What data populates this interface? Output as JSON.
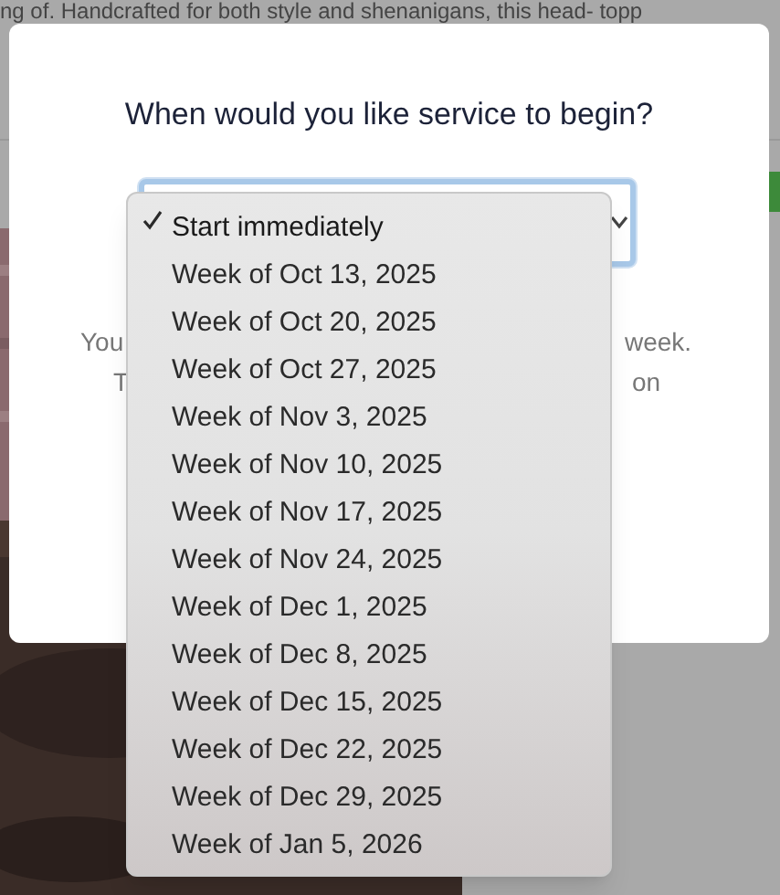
{
  "page": {
    "intro_text": "ng of. Handcrafted for both style and shenanigans, this head- topp"
  },
  "modal": {
    "title": "When would you like service to begin?",
    "note_fragments": [
      "You",
      "week.",
      "T",
      "on"
    ],
    "select": {
      "expanded": true,
      "options": [
        {
          "label": "Start immediately",
          "selected": true
        },
        {
          "label": "Week of Oct 13, 2025",
          "selected": false
        },
        {
          "label": "Week of Oct 20, 2025",
          "selected": false
        },
        {
          "label": "Week of Oct 27, 2025",
          "selected": false
        },
        {
          "label": "Week of Nov 3, 2025",
          "selected": false
        },
        {
          "label": "Week of Nov 10, 2025",
          "selected": false
        },
        {
          "label": "Week of Nov 17, 2025",
          "selected": false
        },
        {
          "label": "Week of Nov 24, 2025",
          "selected": false
        },
        {
          "label": "Week of Dec 1, 2025",
          "selected": false
        },
        {
          "label": "Week of Dec 8, 2025",
          "selected": false
        },
        {
          "label": "Week of Dec 15, 2025",
          "selected": false
        },
        {
          "label": "Week of Dec 22, 2025",
          "selected": false
        },
        {
          "label": "Week of Dec 29, 2025",
          "selected": false
        },
        {
          "label": "Week of Jan 5, 2026",
          "selected": false
        }
      ]
    }
  }
}
